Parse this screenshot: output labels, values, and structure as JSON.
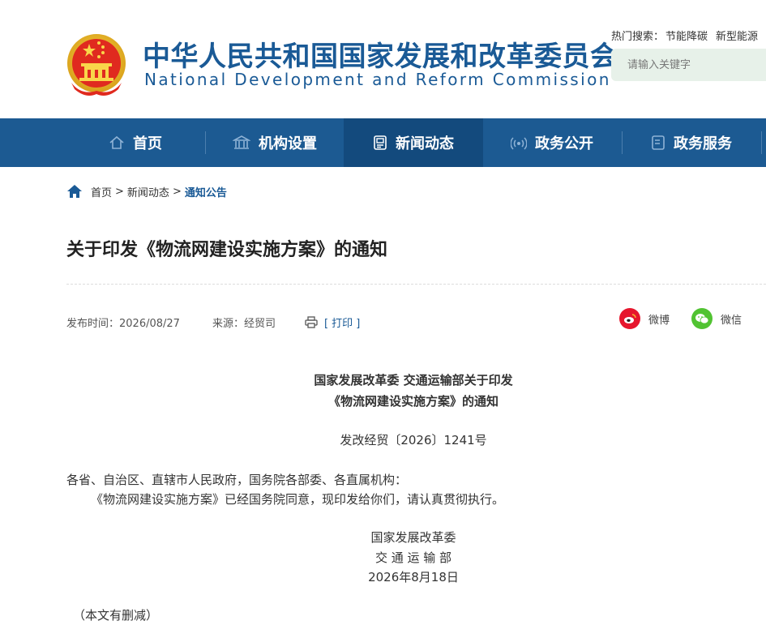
{
  "header": {
    "title_cn": "中华人民共和国国家发展和改革委员会",
    "title_en": "National Development and Reform Commission",
    "hot_search_label": "热门搜索：",
    "hot_keywords": [
      "节能降碳",
      "新型能源"
    ],
    "search_placeholder": "请输入关键字"
  },
  "nav": {
    "items": [
      {
        "label": "首页",
        "icon": "home-icon"
      },
      {
        "label": "机构设置",
        "icon": "institution-icon"
      },
      {
        "label": "新闻动态",
        "icon": "news-icon"
      },
      {
        "label": "政务公开",
        "icon": "broadcast-icon"
      },
      {
        "label": "政务服务",
        "icon": "document-icon"
      }
    ],
    "active_index": 2
  },
  "breadcrumb": {
    "items": [
      "首页",
      "新闻动态",
      "通知公告"
    ],
    "separator": ">"
  },
  "article": {
    "title": "关于印发《物流网建设实施方案》的通知",
    "publish_time": "发布时间：2026/08/27",
    "source": "来源：经贸司",
    "print_label": "[ 打印 ]",
    "share": {
      "weibo": "微博",
      "wechat": "微信"
    },
    "doc_heading_line1": "国家发展改革委 交通运输部关于印发",
    "doc_heading_line2": "《物流网建设实施方案》的通知",
    "doc_number": "发改经贸〔2026〕1241号",
    "addressee": "各省、自治区、直辖市人民政府，国务院各部委、各直属机构：",
    "body": "《物流网建设实施方案》已经国务院同意，现印发给你们，请认真贯彻执行。",
    "signatory1": "国家发展改革委",
    "signatory2": "交 通 运 输 部",
    "sign_date": "2026年8月18日",
    "note": "（本文有删减）"
  },
  "colors": {
    "brand_blue": "#1a5a96",
    "nav_bg": "#1c5a92",
    "nav_active": "#134a7d",
    "search_bg": "#e7f1e9",
    "weibo_red": "#e6162d",
    "wechat_green": "#51c332"
  }
}
